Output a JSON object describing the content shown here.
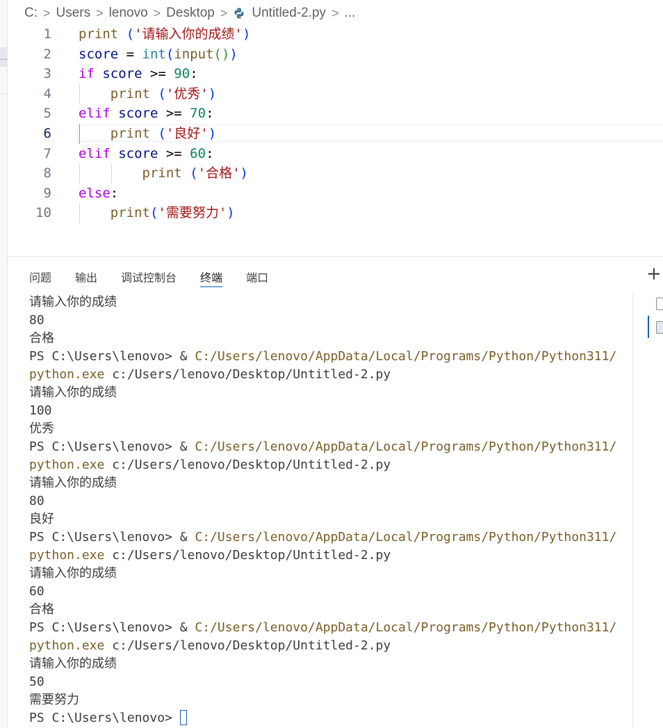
{
  "breadcrumb": {
    "drive": "C:",
    "folder1": "Users",
    "folder2": "lenovo",
    "folder3": "Desktop",
    "file": "Untitled-2.py",
    "more": "...",
    "file_icon": "python-icon"
  },
  "left_strip": {
    "dots": "…"
  },
  "editor": {
    "active_line": "6",
    "lines": [
      {
        "num": "1",
        "tokens": [
          [
            "print",
            "print"
          ],
          [
            " ",
            "op"
          ],
          [
            "(",
            "p1"
          ],
          [
            "'请输入你的成绩'",
            "str"
          ],
          [
            ")",
            "p1"
          ]
        ]
      },
      {
        "num": "2",
        "tokens": [
          [
            "score",
            "var"
          ],
          [
            " = ",
            "op"
          ],
          [
            "int",
            "fn2"
          ],
          [
            "(",
            "p1"
          ],
          [
            "input",
            "print"
          ],
          [
            "()",
            "p2"
          ],
          [
            ")",
            "p1"
          ]
        ]
      },
      {
        "num": "3",
        "tokens": [
          [
            "if",
            "kw"
          ],
          [
            " score ",
            "var"
          ],
          [
            ">= ",
            "op"
          ],
          [
            "90",
            "num"
          ],
          [
            ":",
            "punct"
          ]
        ]
      },
      {
        "num": "4",
        "tokens": [
          [
            "    print",
            "print"
          ],
          [
            " ",
            "op"
          ],
          [
            "(",
            "p1"
          ],
          [
            "'优秀'",
            "str"
          ],
          [
            ")",
            "p1"
          ]
        ]
      },
      {
        "num": "5",
        "tokens": [
          [
            "elif",
            "kw"
          ],
          [
            " score ",
            "var"
          ],
          [
            ">= ",
            "op"
          ],
          [
            "70",
            "num"
          ],
          [
            ":",
            "punct"
          ]
        ]
      },
      {
        "num": "6",
        "tokens": [
          [
            "    print",
            "print"
          ],
          [
            " ",
            "op"
          ],
          [
            "(",
            "p1"
          ],
          [
            "'良好'",
            "str"
          ],
          [
            ")",
            "p1"
          ]
        ]
      },
      {
        "num": "7",
        "tokens": [
          [
            "elif",
            "kw"
          ],
          [
            " score ",
            "var"
          ],
          [
            ">= ",
            "op"
          ],
          [
            "60",
            "num"
          ],
          [
            ":",
            "punct"
          ]
        ]
      },
      {
        "num": "8",
        "tokens": [
          [
            "        print",
            "print"
          ],
          [
            " ",
            "op"
          ],
          [
            "(",
            "p1"
          ],
          [
            "'合格'",
            "str"
          ],
          [
            ")",
            "p1"
          ]
        ]
      },
      {
        "num": "9",
        "tokens": [
          [
            "else",
            "kw"
          ],
          [
            ":",
            "punct"
          ]
        ]
      },
      {
        "num": "10",
        "tokens": [
          [
            "    print",
            "print"
          ],
          [
            "(",
            "p1"
          ],
          [
            "'需要努力'",
            "str"
          ],
          [
            ")",
            "p1"
          ]
        ]
      }
    ]
  },
  "panel": {
    "tabs": [
      {
        "label": "问题",
        "active": false
      },
      {
        "label": "输出",
        "active": false
      },
      {
        "label": "调试控制台",
        "active": false
      },
      {
        "label": "终端",
        "active": true
      },
      {
        "label": "端口",
        "active": false
      }
    ],
    "plus": "+"
  },
  "terminal": {
    "prompt": "PS C:\\Users\\lenovo> & ",
    "exe_path": "C:/Users/lenovo/AppData/Local/Programs/Python/Python311/",
    "exe_name": "python.exe",
    "script": " c:/Users/lenovo/Desktop/Untitled-2.py",
    "ask": "请输入你的成绩",
    "runs": [
      {
        "input": "80",
        "result": "合格"
      },
      {
        "input": "100",
        "result": "优秀"
      },
      {
        "input": "80",
        "result": "良好"
      },
      {
        "input": "60",
        "result": "合格"
      },
      {
        "input": "50",
        "result": "需要努力"
      }
    ],
    "final_prompt": "PS C:\\Users\\lenovo> "
  },
  "colors": {
    "accent": "#005fb8",
    "string": "#a31515",
    "keyword": "#af00db",
    "number": "#098658",
    "function": "#795e26"
  }
}
